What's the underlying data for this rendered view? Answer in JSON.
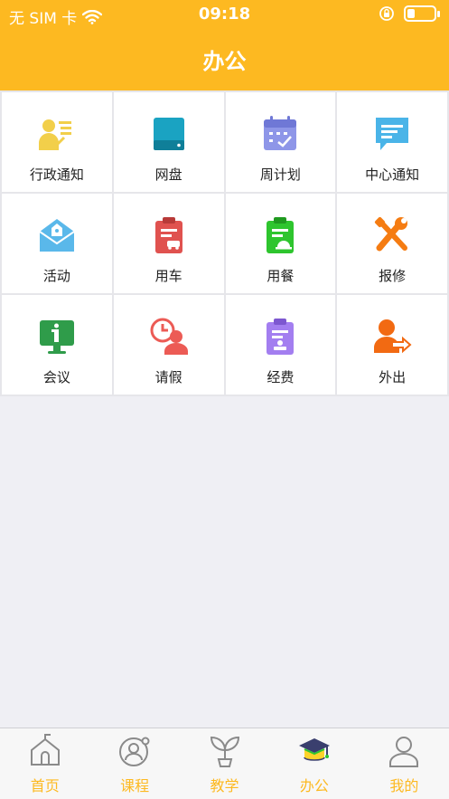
{
  "statusbar": {
    "carrier": "无 SIM 卡",
    "time": "09:18",
    "battery_level": 0.3
  },
  "header": {
    "title": "办公"
  },
  "grid": {
    "items": [
      {
        "label": "行政通知",
        "icon": "admin-notice-icon"
      },
      {
        "label": "网盘",
        "icon": "cloud-drive-icon"
      },
      {
        "label": "周计划",
        "icon": "calendar-icon"
      },
      {
        "label": "中心通知",
        "icon": "message-icon"
      },
      {
        "label": "活动",
        "icon": "envelope-icon"
      },
      {
        "label": "用车",
        "icon": "car-clipboard-icon"
      },
      {
        "label": "用餐",
        "icon": "meal-clipboard-icon"
      },
      {
        "label": "报修",
        "icon": "wrench-screwdriver-icon"
      },
      {
        "label": "会议",
        "icon": "meeting-board-icon"
      },
      {
        "label": "请假",
        "icon": "leave-clock-icon"
      },
      {
        "label": "经费",
        "icon": "expense-clipboard-icon"
      },
      {
        "label": "外出",
        "icon": "person-out-icon"
      }
    ]
  },
  "tabbar": {
    "items": [
      {
        "label": "首页",
        "icon": "home-icon"
      },
      {
        "label": "课程",
        "icon": "course-icon"
      },
      {
        "label": "教学",
        "icon": "sprout-icon"
      },
      {
        "label": "办公",
        "icon": "graduation-cap-icon",
        "active": true
      },
      {
        "label": "我的",
        "icon": "profile-icon"
      }
    ],
    "accent": "#fdb921"
  },
  "colors": {
    "header": "#fdb921",
    "background": "#efeff4"
  }
}
